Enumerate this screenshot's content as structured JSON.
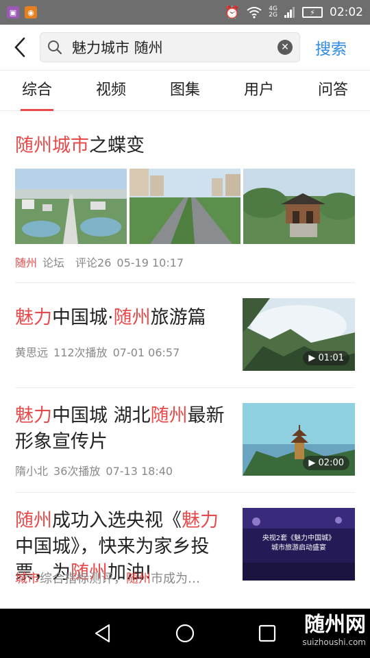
{
  "status_bar": {
    "time": "02:02",
    "network": [
      "4G",
      "2G"
    ],
    "alarm_icon": "alarm-icon",
    "wifi_icon": "wifi-icon"
  },
  "header": {
    "query": "魅力城市 随州",
    "search_label": "搜索"
  },
  "tabs": [
    {
      "label": "综合",
      "active": true
    },
    {
      "label": "视频"
    },
    {
      "label": "图集"
    },
    {
      "label": "用户"
    },
    {
      "label": "问答"
    }
  ],
  "article1": {
    "title_hl": "随州城市",
    "title_rest": "之蝶变",
    "source_hl": "随州",
    "source_rest": "论坛",
    "comments": "评论26",
    "time": "05-19 10:17"
  },
  "video1": {
    "t1": "魅力",
    "t2": "中国城·",
    "t3": "随州",
    "t4": "旅游篇",
    "author": "黄思远",
    "plays": "112次播放",
    "time": "07-01 06:57",
    "duration": "01:01"
  },
  "video2": {
    "t1": "魅力",
    "t2": "中国城 湖北",
    "t3": "随州",
    "t4": "最新形象宣传片",
    "author": "隋小北",
    "plays": "36次播放",
    "time": "07-13 18:40",
    "duration": "02:00"
  },
  "article4": {
    "t1": "随州",
    "t2": "成功入选央视《",
    "t3": "魅力",
    "t4": "中国城》，快来为家乡投票，为",
    "t5": "随州",
    "t6": "加油!",
    "snip1": "城市",
    "snip2": "综合指标测评，",
    "snip3": "随州",
    "snip4": "市成为…",
    "thumb_line1": "央视2套《魅力中国城》",
    "thumb_line2": "城市旅游启动盛宴"
  },
  "watermark": {
    "main": "随州网",
    "sub": "suizhoushi.com"
  }
}
